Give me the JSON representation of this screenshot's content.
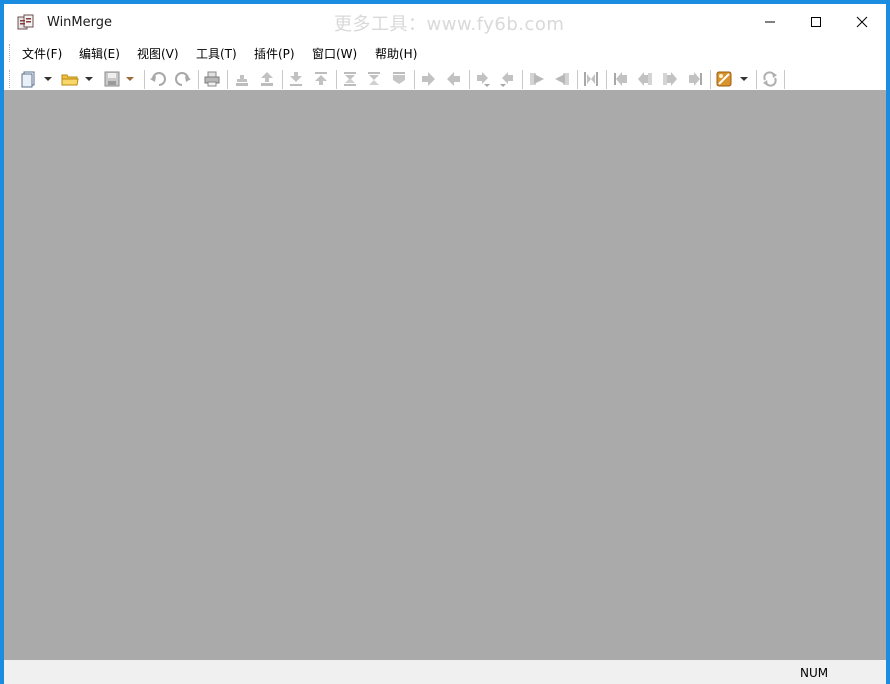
{
  "window": {
    "title": "WinMerge",
    "watermark": "更多工具：www.fy6b.com",
    "border_color": "#1b8de0",
    "controls": [
      "minimize-icon",
      "maximize-icon",
      "close-icon"
    ]
  },
  "menu": {
    "items": [
      {
        "label": "文件(F)"
      },
      {
        "label": "编辑(E)"
      },
      {
        "label": "视图(V)"
      },
      {
        "label": "工具(T)"
      },
      {
        "label": "插件(P)"
      },
      {
        "label": "窗口(W)"
      },
      {
        "label": "帮助(H)"
      }
    ]
  },
  "toolbar": {
    "buttons": [
      "new-icon",
      "new-dropdown-icon",
      "open-icon",
      "open-dropdown-icon",
      "save-icon",
      "save-dropdown-icon",
      "undo-icon",
      "redo-icon",
      "print-icon",
      "next-diff-icon",
      "prev-diff-icon",
      "first-diff-icon",
      "last-diff-icon",
      "current-diff-icon",
      "next-conflict-icon",
      "prev-conflict-icon",
      "copy-right-icon",
      "copy-left-icon",
      "copy-right-advance-icon",
      "copy-left-advance-icon",
      "all-right-icon",
      "all-left-icon",
      "compare-icon",
      "first-file-icon",
      "prev-file-icon",
      "next-file-icon",
      "last-file-icon",
      "options-icon",
      "options-dropdown-icon",
      "refresh-icon"
    ]
  },
  "statusbar": {
    "num_indicator": "NUM"
  },
  "colors": {
    "mdi_background": "#aaaaaa",
    "statusbar_background": "#f0f0f0",
    "accent": "#1b8de0"
  }
}
